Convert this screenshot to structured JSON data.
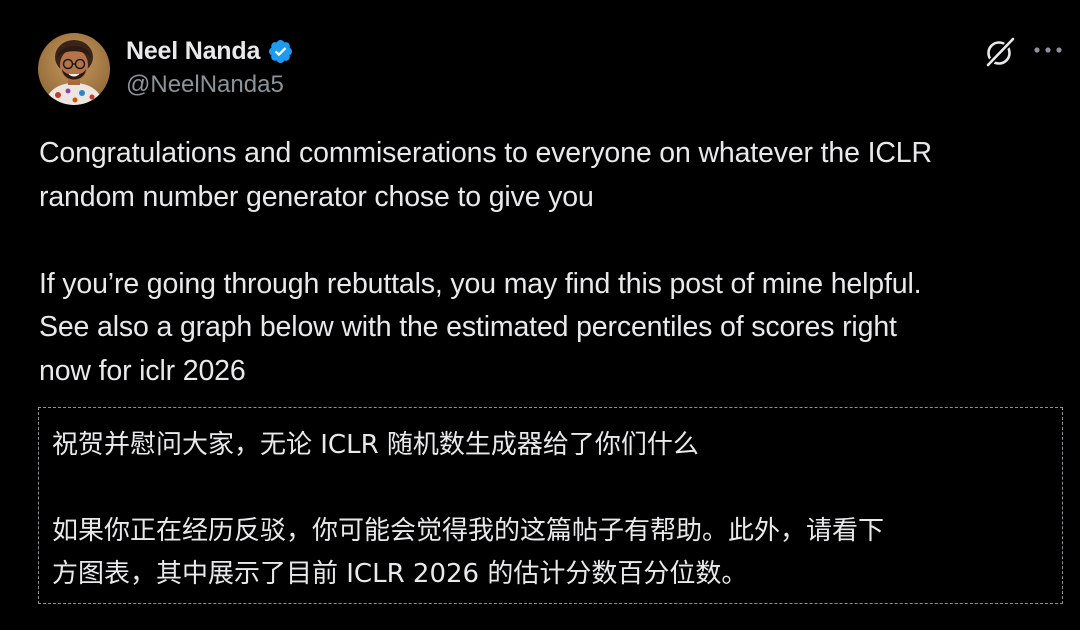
{
  "tweet": {
    "author": {
      "display_name": "Neel Nanda",
      "handle": "@NeelNanda5",
      "verified": true,
      "verified_icon": "verified-badge-icon",
      "verified_color": "#1d9bf0",
      "avatar": "avatar"
    },
    "actions": {
      "grok_icon": "grok-icon",
      "more_icon": "more-icon"
    },
    "text": {
      "paragraph_1": "Congratulations and commiserations to everyone on whatever the ICLR\nrandom number generator chose to give you",
      "paragraph_2": "If you’re going through rebuttals, you may find this post of mine helpful.\nSee also a graph below with the estimated percentiles of scores right\nnow for iclr 2026"
    },
    "translation": {
      "paragraph_1": "祝贺并慰问大家，无论 ICLR 随机数生成器给了你们什么",
      "paragraph_2": "如果你正在经历反驳，你可能会觉得我的这篇帖子有帮助。此外，请看下\n方图表，其中展示了目前 ICLR 2026 的估计分数百分位数。"
    }
  },
  "colors": {
    "background": "#000000",
    "text_primary": "#e7e9ea",
    "text_secondary": "#8b9299",
    "dashed_border": "#8e9297",
    "verified_blue": "#1d9bf0"
  }
}
